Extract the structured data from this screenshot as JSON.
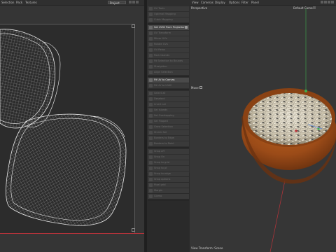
{
  "uv_editor": {
    "menu": [
      "Selection",
      "Pack",
      "Textures"
    ],
    "project_select": "Project"
  },
  "tool_panel": {
    "groups": [
      {
        "items": [
          {
            "label": "UV Tools",
            "active": false
          },
          {
            "label": "Optimal Mapping",
            "active": false
          },
          {
            "label": "Cubic Mapping",
            "active": false
          }
        ]
      },
      {
        "items": [
          {
            "label": "Set UVW From Projection",
            "active": true,
            "check": true
          },
          {
            "label": "UV Transform",
            "active": false
          },
          {
            "label": "Mirror UVs",
            "active": false
          },
          {
            "label": "Rotate UVs",
            "active": false
          },
          {
            "label": "UV Relax",
            "active": false
          },
          {
            "label": "Pack Islands",
            "active": false
          },
          {
            "label": "Fit Selection to Bounds",
            "active": false
          },
          {
            "label": "Straighten",
            "active": false
          },
          {
            "label": "Align Selection",
            "active": false
          }
        ]
      },
      {
        "items": [
          {
            "label": "Fit UV to Canvas",
            "active": true,
            "check": false
          },
          {
            "label": "Fit UV to UVW",
            "active": false
          }
        ]
      },
      {
        "items": [
          {
            "label": "Select all",
            "active": false
          },
          {
            "label": "Deselect",
            "active": false
          },
          {
            "label": "Invert sel",
            "active": false
          },
          {
            "label": "Sel Islands",
            "active": false
          },
          {
            "label": "Sel Overlapping",
            "active": false
          },
          {
            "label": "Sel Flipped",
            "active": false
          },
          {
            "label": "Grow Selection",
            "active": false
          },
          {
            "label": "Shrink Sel",
            "active": false
          },
          {
            "label": "Borders to Edge",
            "active": false
          },
          {
            "label": "Borders to Point",
            "active": false
          }
        ]
      },
      {
        "items": [
          {
            "label": "Snap off",
            "active": false
          },
          {
            "label": "Snap On",
            "active": false
          },
          {
            "label": "Snap to grid",
            "active": false
          },
          {
            "label": "Snap to pt",
            "active": false
          },
          {
            "label": "Snap to edge",
            "active": false
          },
          {
            "label": "Snap options",
            "active": false
          },
          {
            "label": "Pixel grid",
            "active": false
          },
          {
            "label": "Margin",
            "active": false
          },
          {
            "label": "Gizmo",
            "active": false
          }
        ]
      }
    ]
  },
  "viewport": {
    "menu": [
      "View",
      "Cameras",
      "Display",
      "Options",
      "Filter",
      "Panel"
    ],
    "label_perspective": "Perspective",
    "label_camera": "Default Camera",
    "label_move": "Move",
    "label_transform": "View Transform: Scene"
  },
  "colors": {
    "panel_bg": "#353535",
    "uv_wire": "#e8e8e8",
    "axis_red": "#b8333a",
    "axis_green": "#3fae4e",
    "bowl": "#9b4b18"
  }
}
